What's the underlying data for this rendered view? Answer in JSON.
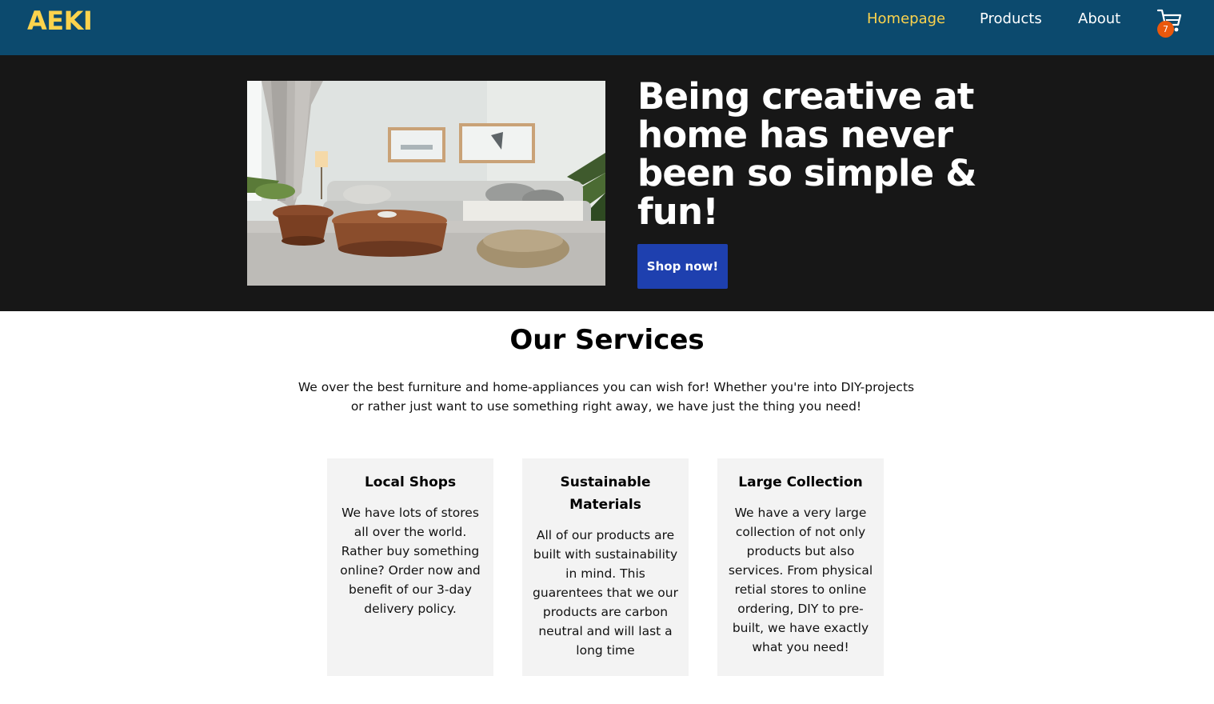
{
  "brand": {
    "logo": "AEKI",
    "accent_color": "#fcd34d",
    "nav_bg": "#0c4a6e"
  },
  "nav": {
    "items": [
      {
        "label": "Homepage",
        "active": true
      },
      {
        "label": "Products",
        "active": false
      },
      {
        "label": "About",
        "active": false
      }
    ],
    "cart": {
      "icon": "shopping-cart-icon",
      "count": "7",
      "badge_color": "#ea580c"
    }
  },
  "hero": {
    "image": "living-room-photo",
    "title": "Being creative at home has never been so simple & fun!",
    "cta_label": "Shop now!",
    "cta_color": "#1e40af",
    "bg_color": "#171717"
  },
  "services": {
    "title": "Our Services",
    "intro": "We over the best furniture and home-appliances you can wish for! Whether you're into DIY-projects or rather just want to use something right away, we have just the thing you need!",
    "cards": [
      {
        "title": "Local Shops",
        "text": "We have lots of stores all over the world. Rather buy something online? Order now and benefit of our 3-day delivery policy."
      },
      {
        "title": "Sustainable Materials",
        "text": "All of our products are built with sustainability in mind. This guarentees that we our products are carbon neutral and will last a long time"
      },
      {
        "title": "Large Collection",
        "text": "We have a very large collection of not only products but also services. From physical retial stores to online ordering, DIY to pre-built, we have exactly what you need!"
      }
    ]
  }
}
